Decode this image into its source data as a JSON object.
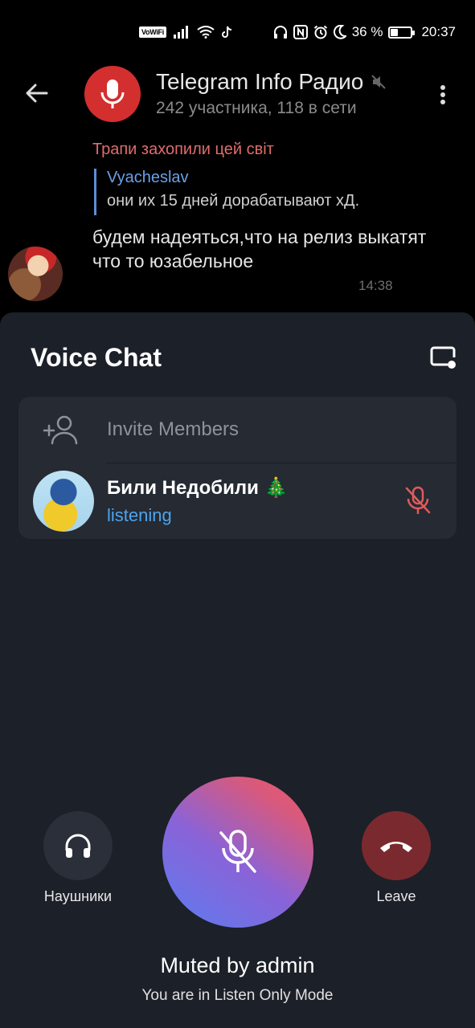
{
  "status_bar": {
    "vowifi": "VoWiFi",
    "battery_percent": "36 %",
    "battery_level": 0.36,
    "time": "20:37",
    "icons": [
      "signal-icon",
      "wifi-icon",
      "tiktok-icon",
      "headset-icon",
      "nfc-icon",
      "alarm-icon",
      "moon-icon",
      "battery-icon"
    ]
  },
  "header": {
    "title": "Telegram Info Радио",
    "subtitle": "242 участника, 118 в сети",
    "avatar_color": "#d32f2f",
    "muted": true
  },
  "message": {
    "author": "Трапи захопили цей світ",
    "author_color": "#e06c6c",
    "reply_name": "Vyacheslav",
    "reply_text": "они их 15 дней дорабатывают хД.",
    "text": "будем надеяться,что на релиз выкатят что то юзабельное",
    "time": "14:38"
  },
  "voice_chat": {
    "title": "Voice Chat",
    "invite_label": "Invite Members",
    "members": [
      {
        "name": "Били Недобили 🎄",
        "status": "listening",
        "mic": "muted"
      }
    ],
    "headphones_label": "Наушники",
    "leave_label": "Leave",
    "muted_title": "Muted by admin",
    "muted_subtitle": "You are in Listen Only Mode",
    "colors": {
      "sheet_bg": "#1c2028",
      "card_bg": "#252a33",
      "listening": "#4ea4ec",
      "muted_mic": "#e05a5a",
      "leave_bg": "#7a2a2e"
    }
  }
}
